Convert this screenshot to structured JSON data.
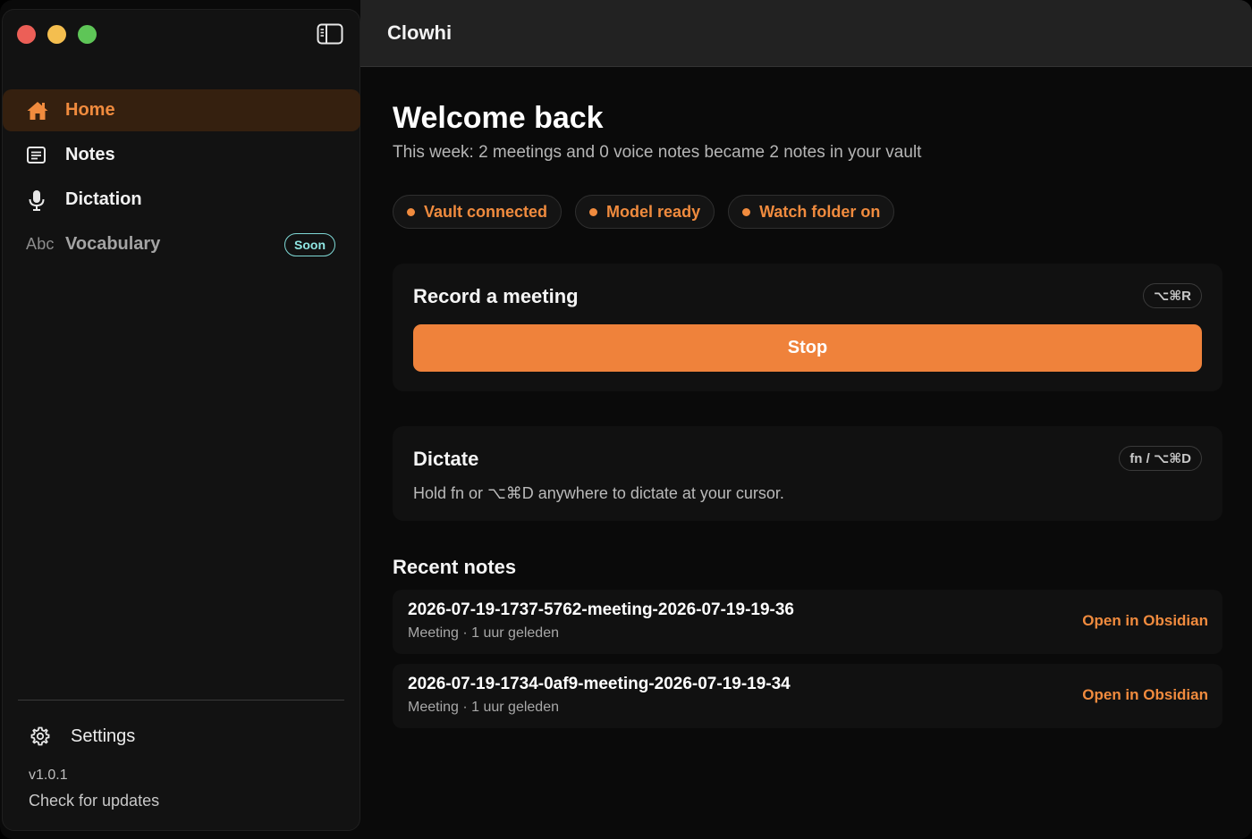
{
  "window": {
    "title": "Clowhi"
  },
  "sidebar": {
    "items": [
      {
        "label": "Home",
        "icon": "home-icon",
        "active": true
      },
      {
        "label": "Notes",
        "icon": "notes-icon"
      },
      {
        "label": "Dictation",
        "icon": "microphone-icon"
      },
      {
        "label": "Vocabulary",
        "icon_text": "Abc",
        "badge": "Soon"
      }
    ],
    "settings_label": "Settings",
    "version": "v1.0.1",
    "updates_label": "Check for updates"
  },
  "main": {
    "welcome": "Welcome back",
    "subtitle": "This week: 2 meetings and 0 voice notes became 2 notes in your vault",
    "chips": [
      {
        "label": "Vault connected"
      },
      {
        "label": "Model ready"
      },
      {
        "label": "Watch folder on"
      }
    ],
    "record": {
      "title": "Record a meeting",
      "shortcut": "⌥⌘R",
      "button_label": "Stop"
    },
    "dictate": {
      "title": "Dictate",
      "shortcut": "fn / ⌥⌘D",
      "description": "Hold fn or ⌥⌘D anywhere to dictate at your cursor."
    },
    "recent": {
      "title": "Recent notes",
      "open_label": "Open in Obsidian",
      "notes": [
        {
          "name": "2026-07-19-1737-5762-meeting-2026-07-19-19-36",
          "meta": "Meeting · 1 uur geleden"
        },
        {
          "name": "2026-07-19-1734-0af9-meeting-2026-07-19-19-34",
          "meta": "Meeting · 1 uur geleden"
        }
      ]
    }
  },
  "colors": {
    "accent": "#ef823b",
    "accent_text": "#f08b3e",
    "badge": "#8fe6e2",
    "active_bg": "#35200f"
  }
}
